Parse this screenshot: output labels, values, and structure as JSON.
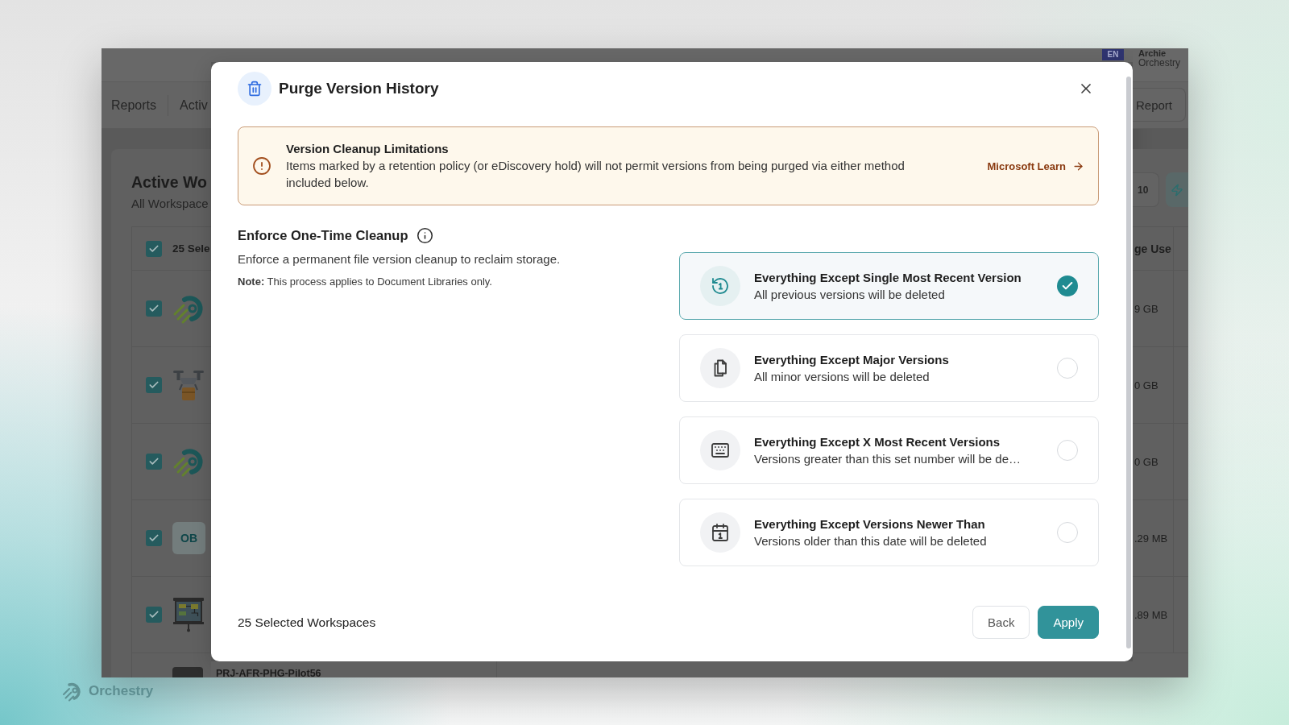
{
  "brand": {
    "name": "Orchestry"
  },
  "app": {
    "header": {
      "language": "EN",
      "user_name": "Archie",
      "user_org": "Orchestry"
    },
    "nav": {
      "tabs": [
        "Reports",
        "Activ"
      ],
      "report_button": "Report"
    },
    "card": {
      "title": "Active Wo",
      "subtitle": "All Workspace",
      "page_size": "10",
      "table": {
        "select_all": {
          "label": "25 Sele",
          "checked": true
        },
        "storage_header": "ge Use",
        "rows": [
          {
            "checked": true,
            "kind": "image",
            "storage": "9 GB"
          },
          {
            "checked": true,
            "kind": "image",
            "storage": "0 GB"
          },
          {
            "checked": true,
            "kind": "image",
            "storage": "0 GB"
          },
          {
            "checked": true,
            "kind": "initials",
            "initials": "OB",
            "storage": ".29 MB"
          },
          {
            "checked": true,
            "kind": "image",
            "storage": ".89 MB"
          }
        ],
        "partial_row": {
          "name": "PRJ-AFR-PHG-Pilot56"
        }
      }
    }
  },
  "dialog": {
    "title": "Purge Version History",
    "notice": {
      "title": "Version Cleanup Limitations",
      "text": "Items marked by a retention policy (or eDiscovery hold) will not permit versions from being purged via either method included below.",
      "link": "Microsoft Learn"
    },
    "section": {
      "title": "Enforce One-Time Cleanup",
      "description": "Enforce a permanent file version cleanup to reclaim storage.",
      "note": "**Note:** This process applies to Document Libraries only."
    },
    "options": [
      {
        "title": "Everything Except Single Most Recent Version",
        "subtitle": "All previous versions will be deleted",
        "selected": true
      },
      {
        "title": "Everything Except Major Versions",
        "subtitle": "All minor versions will be deleted",
        "selected": false
      },
      {
        "title": "Everything Except X Most Recent Versions",
        "subtitle": "Versions greater than this set number will be de…",
        "selected": false
      },
      {
        "title": "Everything Except Versions Newer Than",
        "subtitle": "Versions older than this date will be deleted",
        "selected": false
      }
    ],
    "selection_count": "25 Selected Workspaces",
    "buttons": [
      {
        "label": "Back",
        "kind": "secondary"
      },
      {
        "label": "Apply",
        "kind": "primary"
      }
    ]
  }
}
